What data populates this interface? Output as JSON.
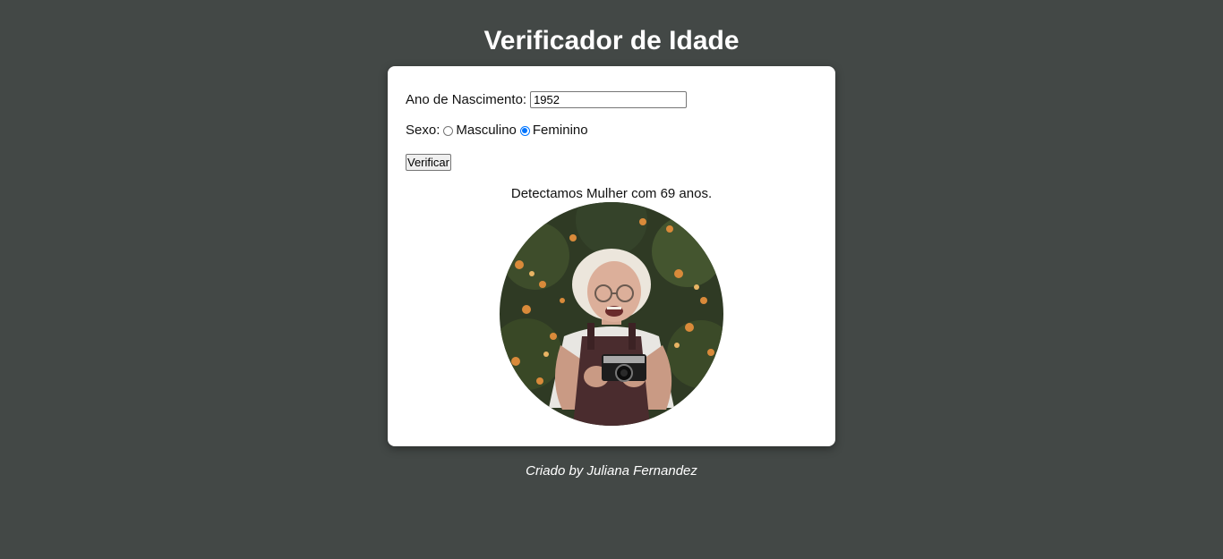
{
  "header": {
    "title": "Verificador de Idade"
  },
  "form": {
    "year_label": "Ano de Nascimento:",
    "year_value": "1952",
    "sex_label": "Sexo:",
    "sex_options": [
      {
        "label": "Masculino",
        "checked": false
      },
      {
        "label": "Feminino",
        "checked": true
      }
    ],
    "submit_label": "Verificar"
  },
  "result": {
    "text": "Detectamos Mulher com 69 anos.",
    "photo_icon": "elderly-woman-photo"
  },
  "footer": {
    "text": "Criado by Juliana Fernandez"
  },
  "colors": {
    "background": "#434846",
    "card": "#ffffff",
    "radio_accent": "#0075ff"
  }
}
